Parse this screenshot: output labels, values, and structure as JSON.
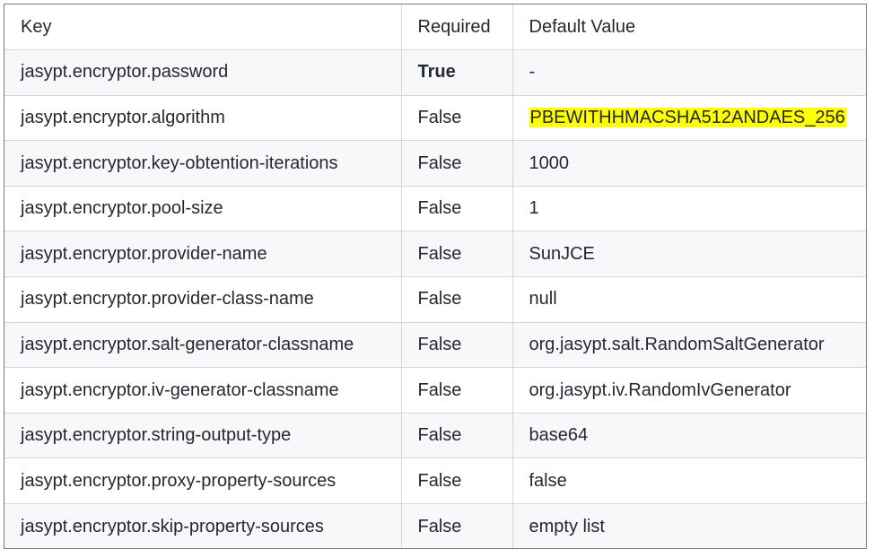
{
  "table": {
    "headers": {
      "key": "Key",
      "required": "Required",
      "default": "Default Value"
    },
    "rows": [
      {
        "key": "jasypt.encryptor.password",
        "required": "True",
        "default": "-"
      },
      {
        "key": "jasypt.encryptor.algorithm",
        "required": "False",
        "default": "PBEWITHHMACSHA512ANDAES_256"
      },
      {
        "key": "jasypt.encryptor.key-obtention-iterations",
        "required": "False",
        "default": "1000"
      },
      {
        "key": "jasypt.encryptor.pool-size",
        "required": "False",
        "default": "1"
      },
      {
        "key": "jasypt.encryptor.provider-name",
        "required": "False",
        "default": "SunJCE"
      },
      {
        "key": "jasypt.encryptor.provider-class-name",
        "required": "False",
        "default": "null"
      },
      {
        "key": "jasypt.encryptor.salt-generator-classname",
        "required": "False",
        "default": "org.jasypt.salt.RandomSaltGenerator"
      },
      {
        "key": "jasypt.encryptor.iv-generator-classname",
        "required": "False",
        "default": "org.jasypt.iv.RandomIvGenerator"
      },
      {
        "key": "jasypt.encryptor.string-output-type",
        "required": "False",
        "default": "base64"
      },
      {
        "key": "jasypt.encryptor.proxy-property-sources",
        "required": "False",
        "default": "false"
      },
      {
        "key": "jasypt.encryptor.skip-property-sources",
        "required": "False",
        "default": "empty list"
      }
    ]
  },
  "styles": {
    "highlight_color": "#ffff00",
    "zebra_color": "#f6f8fa",
    "border_color": "#d0d7de"
  }
}
